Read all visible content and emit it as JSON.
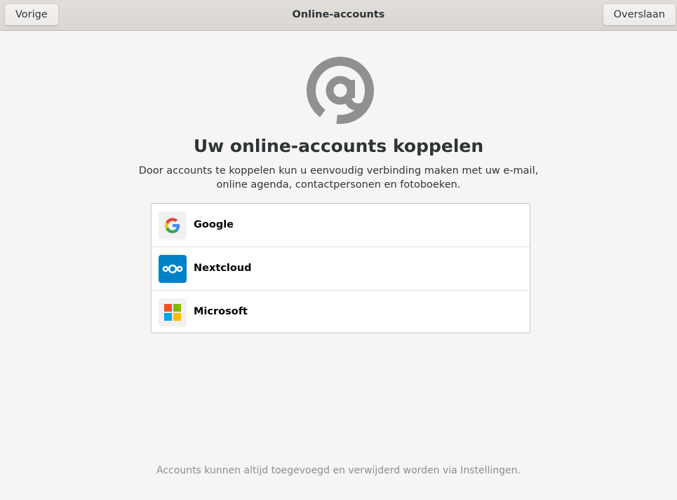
{
  "headerbar": {
    "title": "Online-accounts",
    "back_label": "Vorige",
    "skip_label": "Overslaan"
  },
  "main": {
    "icon": "at-sign-icon",
    "heading": "Uw online-accounts koppelen",
    "description_line1": "Door accounts te koppelen kun u eenvoudig verbinding maken met uw e-mail,",
    "description_line2": "online agenda, contactpersonen en fotoboeken."
  },
  "accounts": [
    {
      "label": "Google",
      "icon": "google-icon"
    },
    {
      "label": "Nextcloud",
      "icon": "nextcloud-icon"
    },
    {
      "label": "Microsoft",
      "icon": "microsoft-icon"
    }
  ],
  "footer": {
    "note": "Accounts kunnen altijd toegevoegd en verwijderd worden via Instellingen."
  },
  "colors": {
    "background": "#f6f5f4",
    "text": "#2e3436",
    "muted_text": "#8b8e8f",
    "icon_gray": "#8e9190",
    "nextcloud_blue": "#0082c9"
  }
}
